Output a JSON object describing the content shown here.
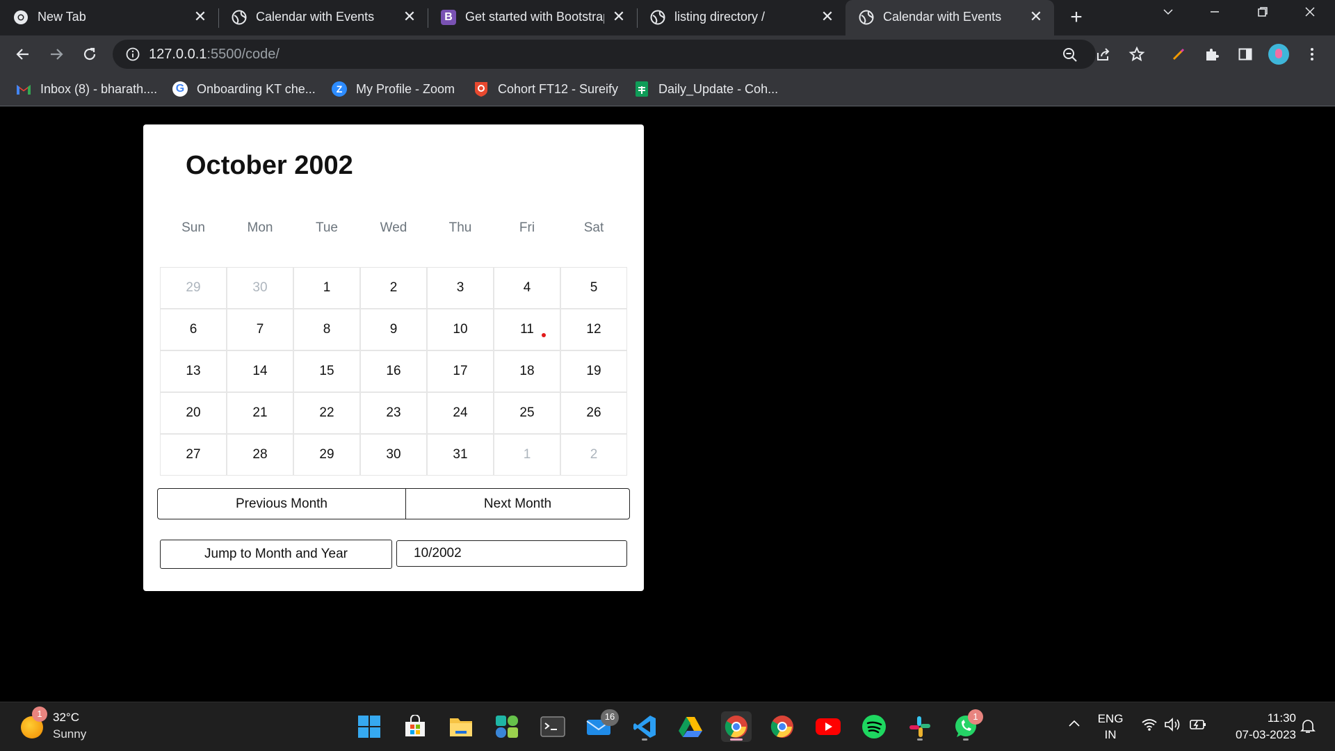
{
  "browser": {
    "tabs": [
      {
        "title": "New Tab",
        "icon": "chrome-icon"
      },
      {
        "title": "Calendar with Events",
        "icon": "globe-icon"
      },
      {
        "title": "Get started with Bootstrap",
        "icon": "bootstrap-icon"
      },
      {
        "title": "listing directory /",
        "icon": "globe-icon"
      },
      {
        "title": "Calendar with Events",
        "icon": "globe-icon",
        "active": true
      }
    ],
    "url_host": "127.0.0.1",
    "url_path": ":5500/code/",
    "bookmarks": [
      {
        "label": "Inbox (8) - bharath....",
        "icon": "gmail-icon"
      },
      {
        "label": "Onboarding KT che...",
        "icon": "google-icon"
      },
      {
        "label": "My Profile - Zoom",
        "icon": "zoom-icon"
      },
      {
        "label": "Cohort FT12 - Sureify",
        "icon": "sureify-icon"
      },
      {
        "label": "Daily_Update - Coh...",
        "icon": "sheets-icon"
      }
    ]
  },
  "calendar": {
    "title": "October 2002",
    "weekdays": [
      "Sun",
      "Mon",
      "Tue",
      "Wed",
      "Thu",
      "Fri",
      "Sat"
    ],
    "weeks": [
      [
        {
          "d": "29",
          "m": true
        },
        {
          "d": "30",
          "m": true
        },
        {
          "d": "1"
        },
        {
          "d": "2"
        },
        {
          "d": "3"
        },
        {
          "d": "4"
        },
        {
          "d": "5"
        }
      ],
      [
        {
          "d": "6"
        },
        {
          "d": "7"
        },
        {
          "d": "8"
        },
        {
          "d": "9"
        },
        {
          "d": "10"
        },
        {
          "d": "11",
          "event": true
        },
        {
          "d": "12"
        }
      ],
      [
        {
          "d": "13"
        },
        {
          "d": "14"
        },
        {
          "d": "15"
        },
        {
          "d": "16"
        },
        {
          "d": "17"
        },
        {
          "d": "18"
        },
        {
          "d": "19"
        }
      ],
      [
        {
          "d": "20"
        },
        {
          "d": "21"
        },
        {
          "d": "22"
        },
        {
          "d": "23"
        },
        {
          "d": "24"
        },
        {
          "d": "25"
        },
        {
          "d": "26"
        }
      ],
      [
        {
          "d": "27"
        },
        {
          "d": "28"
        },
        {
          "d": "29"
        },
        {
          "d": "30"
        },
        {
          "d": "31"
        },
        {
          "d": "1",
          "m": true
        },
        {
          "d": "2",
          "m": true
        }
      ]
    ],
    "prev_label": "Previous Month",
    "next_label": "Next Month",
    "jump_label": "Jump to Month and Year",
    "jump_value": "10/2002",
    "event_color": "#e21b1b"
  },
  "taskbar": {
    "weather_temp": "32°C",
    "weather_desc": "Sunny",
    "weather_badge": "1",
    "mail_badge": "16",
    "whatsapp_badge": "1",
    "lang": "ENG",
    "region": "IN",
    "time": "11:30",
    "date": "07-03-2023"
  }
}
